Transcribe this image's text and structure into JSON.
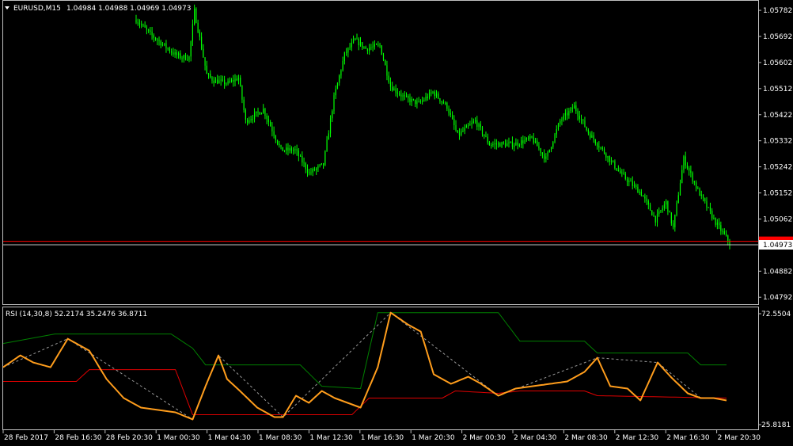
{
  "header": {
    "symbol": "EURUSD,M15",
    "ohlc": "1.04984 1.04988 1.04969 1.04973",
    "menu_icon": "triangle-down-icon"
  },
  "rsi_header": "RSI (14,30,8) 52.2174 35.2476 36.8711",
  "price_axis": {
    "ticks": [
      "1.05782",
      "1.05692",
      "1.05602",
      "1.05512",
      "1.05422",
      "1.05332",
      "1.05242",
      "1.05152",
      "1.05062",
      "1.04882",
      "1.04792"
    ],
    "current_price": "1.04973"
  },
  "rsi_axis": {
    "ticks": [
      "72.5504",
      "25.8181"
    ]
  },
  "time_axis": {
    "ticks": [
      "28 Feb 2017",
      "28 Feb 16:30",
      "28 Feb 20:30",
      "1 Mar 00:30",
      "1 Mar 04:30",
      "1 Mar 08:30",
      "1 Mar 12:30",
      "1 Mar 16:30",
      "1 Mar 20:30",
      "2 Mar 00:30",
      "2 Mar 04:30",
      "2 Mar 08:30",
      "2 Mar 12:30",
      "2 Mar 16:30",
      "2 Mar 20:30"
    ]
  },
  "colors": {
    "background": "#000000",
    "frame": "#c0c0c0",
    "candle": "#00ff00",
    "hline_red": "#ff0000",
    "hline_gray": "#c0c0c0",
    "rsi": "#ff9d1c",
    "upper_band": "#008000",
    "lower_band": "#e00000",
    "zigzag": "#9a9a9a"
  },
  "chart_data": [
    {
      "type": "candlestick",
      "title": "EURUSD,M15",
      "ylim": [
        1.04768,
        1.05815
      ],
      "close_path": [
        [
          0,
          1.0575
        ],
        [
          8,
          1.057
        ],
        [
          16,
          1.0566
        ],
        [
          22,
          1.0563
        ],
        [
          26,
          1.0562
        ],
        [
          30,
          1.0562
        ],
        [
          33,
          1.0578
        ],
        [
          40,
          1.0556
        ],
        [
          44,
          1.0554
        ],
        [
          52,
          1.0553
        ],
        [
          58,
          1.0555
        ],
        [
          62,
          1.054
        ],
        [
          72,
          1.0544
        ],
        [
          82,
          1.053
        ],
        [
          90,
          1.053
        ],
        [
          98,
          1.0522
        ],
        [
          106,
          1.0525
        ],
        [
          112,
          1.0548
        ],
        [
          118,
          1.0563
        ],
        [
          124,
          1.0568
        ],
        [
          130,
          1.0565
        ],
        [
          138,
          1.0566
        ],
        [
          144,
          1.0552
        ],
        [
          152,
          1.0548
        ],
        [
          160,
          1.0546
        ],
        [
          168,
          1.055
        ],
        [
          176,
          1.0545
        ],
        [
          182,
          1.0535
        ],
        [
          192,
          1.054
        ],
        [
          200,
          1.0532
        ],
        [
          214,
          1.0532
        ],
        [
          224,
          1.0534
        ],
        [
          232,
          1.0527
        ],
        [
          240,
          1.054
        ],
        [
          248,
          1.0545
        ],
        [
          256,
          1.0536
        ],
        [
          264,
          1.053
        ],
        [
          274,
          1.0522
        ],
        [
          286,
          1.0515
        ],
        [
          294,
          1.0506
        ],
        [
          300,
          1.0512
        ],
        [
          304,
          1.0503
        ],
        [
          310,
          1.0527
        ],
        [
          318,
          1.0516
        ],
        [
          328,
          1.0505
        ],
        [
          336,
          1.0498
        ]
      ],
      "current_price": 1.04973,
      "red_line_price": 1.04985
    },
    {
      "type": "line",
      "title": "RSI (14,30,8)",
      "ylim": [
        25.8181,
        72.5504
      ],
      "last_values": [
        52.2174,
        35.2476,
        36.8711
      ],
      "rsi": [
        [
          0,
          50
        ],
        [
          8,
          55
        ],
        [
          14,
          52
        ],
        [
          22,
          50
        ],
        [
          30,
          62
        ],
        [
          40,
          57
        ],
        [
          48,
          45
        ],
        [
          56,
          37
        ],
        [
          64,
          33
        ],
        [
          72,
          32
        ],
        [
          80,
          31
        ],
        [
          88,
          28
        ],
        [
          94,
          42
        ],
        [
          100,
          55
        ],
        [
          104,
          45
        ],
        [
          110,
          40
        ],
        [
          118,
          33
        ],
        [
          126,
          29
        ],
        [
          130,
          29
        ],
        [
          136,
          38
        ],
        [
          142,
          35
        ],
        [
          148,
          40
        ],
        [
          154,
          37
        ],
        [
          160,
          35
        ],
        [
          166,
          33
        ],
        [
          174,
          50
        ],
        [
          180,
          73
        ],
        [
          188,
          68
        ],
        [
          194,
          65
        ],
        [
          200,
          47
        ],
        [
          208,
          43
        ],
        [
          216,
          46
        ],
        [
          222,
          43
        ],
        [
          230,
          38
        ],
        [
          238,
          41
        ],
        [
          246,
          42
        ],
        [
          254,
          43
        ],
        [
          262,
          44
        ],
        [
          270,
          48
        ],
        [
          276,
          54
        ],
        [
          282,
          42
        ],
        [
          290,
          41
        ],
        [
          296,
          36
        ],
        [
          304,
          52
        ],
        [
          310,
          46
        ],
        [
          318,
          39
        ],
        [
          324,
          37
        ],
        [
          330,
          37
        ],
        [
          336,
          36
        ]
      ],
      "upper_band": [
        [
          0,
          60
        ],
        [
          24,
          64
        ],
        [
          78,
          64
        ],
        [
          88,
          58
        ],
        [
          94,
          51
        ],
        [
          138,
          51
        ],
        [
          148,
          42
        ],
        [
          166,
          41
        ],
        [
          174,
          73
        ],
        [
          230,
          73
        ],
        [
          240,
          61
        ],
        [
          270,
          61
        ],
        [
          276,
          56
        ],
        [
          318,
          56
        ],
        [
          324,
          51
        ],
        [
          336,
          51
        ]
      ],
      "lower_band": [
        [
          0,
          44
        ],
        [
          34,
          44
        ],
        [
          40,
          49
        ],
        [
          80,
          49
        ],
        [
          88,
          30
        ],
        [
          162,
          30
        ],
        [
          170,
          37
        ],
        [
          204,
          37
        ],
        [
          210,
          40
        ],
        [
          230,
          39
        ],
        [
          240,
          40
        ],
        [
          270,
          40
        ],
        [
          276,
          38
        ],
        [
          336,
          37
        ]
      ]
    }
  ]
}
